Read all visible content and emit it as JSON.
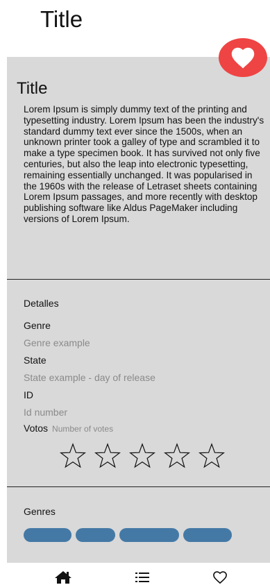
{
  "header": {
    "title": "Title"
  },
  "card": {
    "title": "Title",
    "description": "Lorem Ipsum is simply dummy text of the printing and typesetting industry. Lorem Ipsum has been the industry's standard dummy text ever since the 1500s, when an unknown printer took a galley of type and scrambled it to make a type specimen book. It has survived not only five centuries, but also the leap into electronic typesetting, remaining essentially unchanged. It was popularised in the 1960s with the release of Letraset sheets containing Lorem Ipsum passages, and more recently with desktop publishing software like Aldus PageMaker including versions of Lorem Ipsum.",
    "favorite_icon": "heart-icon"
  },
  "details": {
    "heading": "Detalles",
    "genre_label": "Genre",
    "genre_value": "Genre example",
    "state_label": "State",
    "state_value": "State example - day of release",
    "id_label": "ID",
    "id_value": "Id number",
    "votes_label": "Votos",
    "votes_value": "Number of votes",
    "rating": {
      "max_stars": 5,
      "filled_stars": 0
    }
  },
  "genres": {
    "heading": "Genres",
    "chip_count": 4
  },
  "bottom_nav": {
    "items": [
      "home-icon",
      "list-icon",
      "heart-outline-icon"
    ]
  },
  "colors": {
    "background": "#ffffff",
    "card": "#d9d9d9",
    "favorite": "#ef4444",
    "chip": "#4479a6",
    "muted_text": "#8a8a8a"
  }
}
